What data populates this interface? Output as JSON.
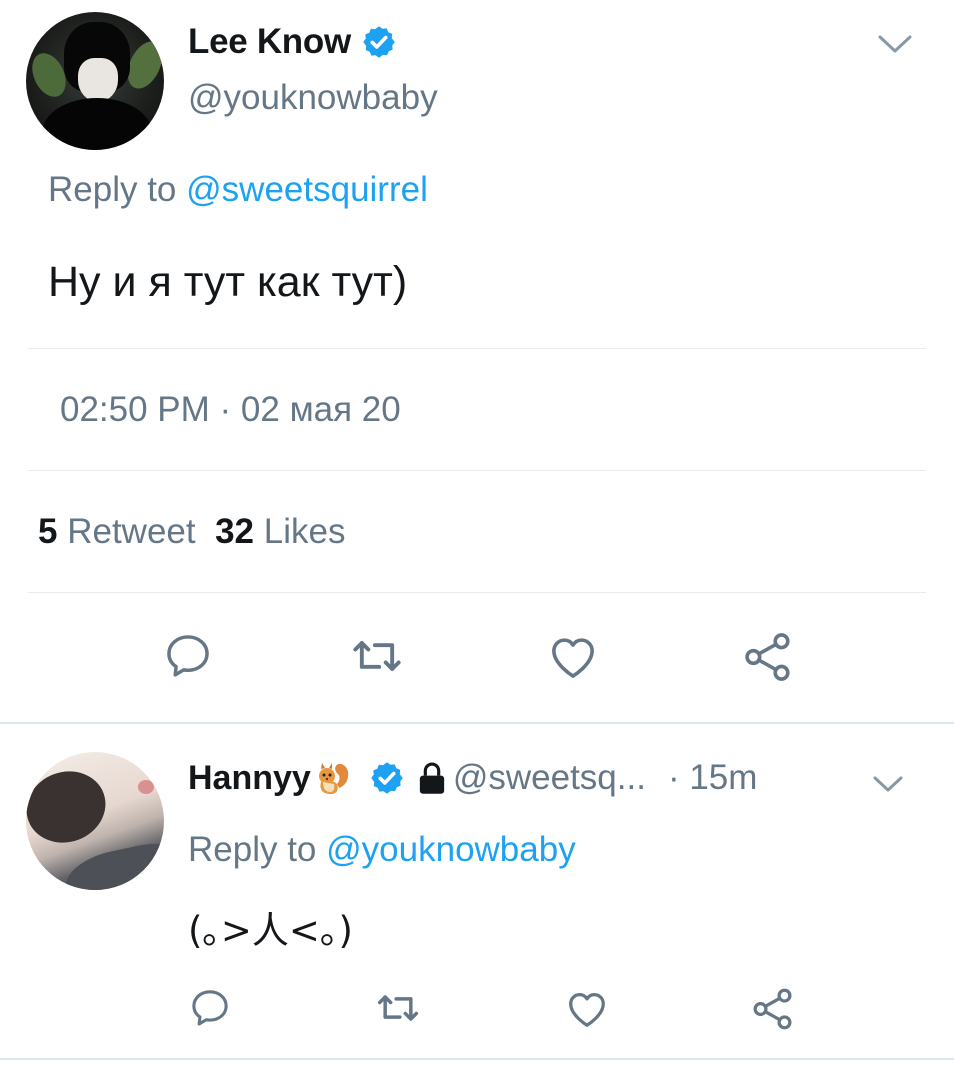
{
  "tweet": {
    "author": {
      "name": "Lee Know",
      "handle": "@youknowbaby",
      "verified": true
    },
    "reply_prefix": "Reply to",
    "reply_to": "@sweetsquirrel",
    "text": "Ну и я тут как тут)",
    "timestamp": "02:50 PM · 02 мая 20",
    "retweet_count": "5",
    "retweet_label": "Retweet",
    "like_count": "32",
    "like_label": "Likes",
    "actions": [
      "comment-icon",
      "retweet-icon",
      "like-icon",
      "share-icon"
    ]
  },
  "reply": {
    "author": {
      "name": "Hannyy",
      "handle": "@sweetsq...",
      "verified": true,
      "protected": true
    },
    "time": "· 15m",
    "reply_prefix": "Reply to",
    "reply_to": "@youknowbaby",
    "text": "(｡>人<｡)",
    "actions": [
      "comment-icon",
      "retweet-icon",
      "like-icon",
      "share-icon"
    ]
  },
  "colors": {
    "accent": "#1da1f2",
    "secondary_text": "#657786",
    "primary_text": "#14171a",
    "icon": "#657786",
    "divider": "#e6ecf0"
  }
}
